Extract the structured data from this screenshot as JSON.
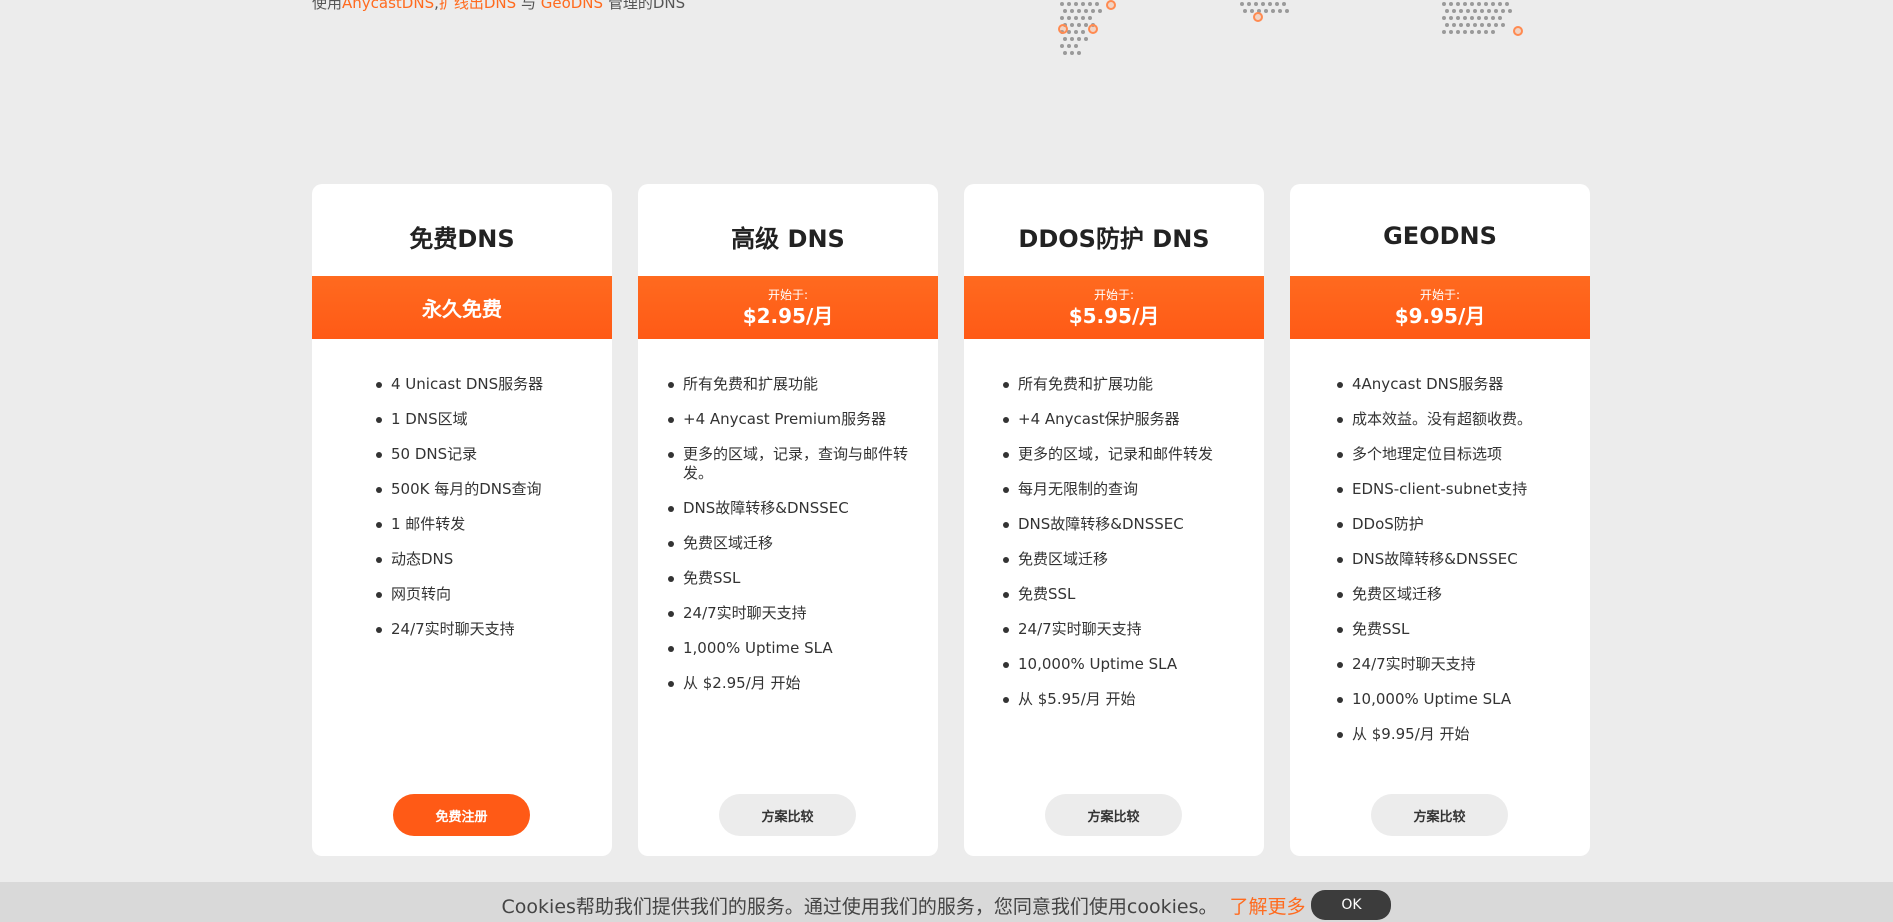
{
  "hero": {
    "prefix": "使用",
    "link1": "AnycastDNS",
    "sep1": ",",
    "link2": "扩线出DNS",
    "sep2": " 与 ",
    "link3": "GeoDNS",
    "suffix": " 管理的DNS"
  },
  "plans": [
    {
      "title": "免费DNS",
      "band_single": "永久免费",
      "features": [
        "4 Unicast DNS服务器",
        "1 DNS区域",
        "50 DNS记录",
        "500K 每月的DNS查询",
        "1 邮件转发",
        "动态DNS",
        "网页转向",
        "24/7实时聊天支持"
      ],
      "button": "免费注册"
    },
    {
      "title": "高级 DNS",
      "band_from": "开始于:",
      "band_price": "$2.95/月",
      "features": [
        "所有免费和扩展功能",
        "+4 Anycast Premium服务器",
        "更多的区域，记录，查询与邮件转发。",
        "DNS故障转移&DNSSEC",
        "免费区域迁移",
        "免费SSL",
        "24/7实时聊天支持",
        "1,000% Uptime SLA",
        "从 $2.95/月 开始"
      ],
      "button": "方案比较"
    },
    {
      "title": "DDOS防护 DNS",
      "band_from": "开始于:",
      "band_price": "$5.95/月",
      "features": [
        "所有免费和扩展功能",
        "+4 Anycast保护服务器",
        "更多的区域，记录和邮件转发",
        "每月无限制的查询",
        "DNS故障转移&DNSSEC",
        "免费区域迁移",
        "免费SSL",
        "24/7实时聊天支持",
        "10,000% Uptime SLA",
        "从 $5.95/月 开始"
      ],
      "button": "方案比较"
    },
    {
      "title": "GEODNS",
      "band_from": "开始于:",
      "band_price": "$9.95/月",
      "features": [
        "4Anycast DNS服务器",
        "成本效益。没有超额收费。",
        "多个地理定位目标选项",
        "EDNS-client-subnet支持",
        "DDoS防护",
        "DNS故障转移&DNSSEC",
        "免费区域迁移",
        "免费SSL",
        "24/7实时聊天支持",
        "10,000% Uptime SLA",
        "从 $9.95/月 开始"
      ],
      "button": "方案比较"
    }
  ],
  "cookie": {
    "text": "Cookies帮助我们提供我们的服务。通过使用我们的服务，您同意我们使用cookies。",
    "more": "了解更多",
    "ok": "OK"
  },
  "colors": {
    "accent": "#ff5a16",
    "background": "#ececec"
  }
}
